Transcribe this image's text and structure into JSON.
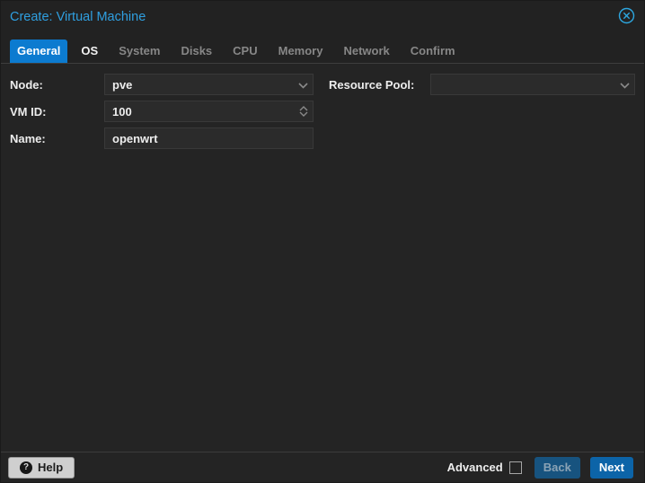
{
  "dialog": {
    "title": "Create: Virtual Machine"
  },
  "tabs": [
    {
      "label": "General",
      "state": "active"
    },
    {
      "label": "OS",
      "state": "enabled"
    },
    {
      "label": "System",
      "state": "disabled"
    },
    {
      "label": "Disks",
      "state": "disabled"
    },
    {
      "label": "CPU",
      "state": "disabled"
    },
    {
      "label": "Memory",
      "state": "disabled"
    },
    {
      "label": "Network",
      "state": "disabled"
    },
    {
      "label": "Confirm",
      "state": "disabled"
    }
  ],
  "form": {
    "node": {
      "label": "Node:",
      "value": "pve",
      "type": "combobox"
    },
    "vmid": {
      "label": "VM ID:",
      "value": "100",
      "type": "spinner"
    },
    "name": {
      "label": "Name:",
      "value": "openwrt",
      "type": "text"
    },
    "resource_pool": {
      "label": "Resource Pool:",
      "value": "",
      "type": "combobox"
    }
  },
  "footer": {
    "help_label": "Help",
    "help_icon": "question-circle-icon",
    "advanced_label": "Advanced",
    "advanced_checked": false,
    "back_label": "Back",
    "back_enabled": false,
    "next_label": "Next",
    "next_enabled": true
  },
  "icons": {
    "close": "circle-x-icon",
    "combo_trigger": "chevron-down-icon",
    "spinner": "chevron-up-down-icon"
  },
  "colors": {
    "title_text": "#2f9fe0",
    "active_tab_bg": "#0c7bd0",
    "disabled_tab_text": "#878787",
    "dialog_bg": "#242424",
    "field_bg": "#2b2b2b",
    "next_button_bg": "#0c64a8",
    "back_button_bg": "#17537f",
    "help_button_bg": "#cfcfcf",
    "close_icon": "#2da7e0"
  }
}
